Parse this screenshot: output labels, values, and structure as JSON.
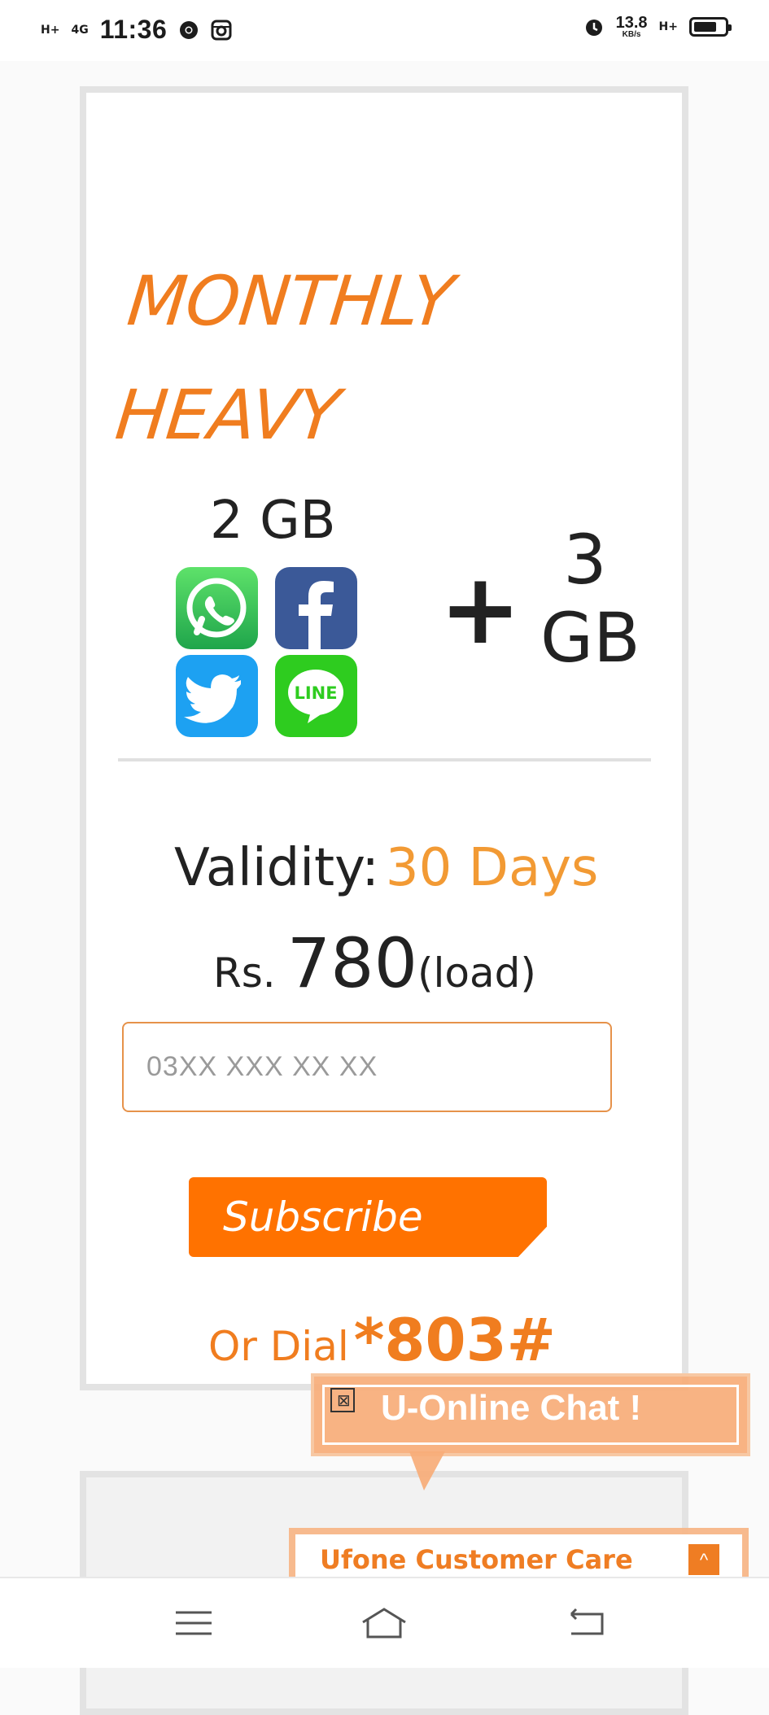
{
  "status_bar": {
    "signal_1": "H+",
    "signal_2": "4G",
    "time": "11:36",
    "speed_value": "13.8",
    "speed_unit": "KB/s",
    "network": "H+",
    "battery_level": 0.75
  },
  "offer": {
    "title_line1": "MONTHLY",
    "title_line2": "HEAVY",
    "social_data": "2 GB",
    "apps": [
      {
        "name": "whatsapp-icon"
      },
      {
        "name": "facebook-icon"
      },
      {
        "name": "twitter-icon"
      },
      {
        "name": "line-icon"
      }
    ],
    "plus": "+",
    "extra_data_amount": "3",
    "extra_data_unit": "GB",
    "validity_label": "Validity:",
    "validity_value": "30 Days",
    "price_currency": "Rs.",
    "price_amount": "780",
    "price_suffix": "(load)",
    "phone_placeholder": "03XX XXX XX XX",
    "subscribe_label": "Subscribe",
    "dial_prefix": "Or Dial",
    "dial_code": "*803#"
  },
  "chat": {
    "bubble_label": "U-Online Chat !",
    "close_glyph": "⊠",
    "care_label": "Ufone Customer Care",
    "care_toggle_glyph": "^"
  },
  "colors": {
    "accent": "#f07d1f",
    "button": "#ff7200",
    "days": "#f29a34"
  }
}
